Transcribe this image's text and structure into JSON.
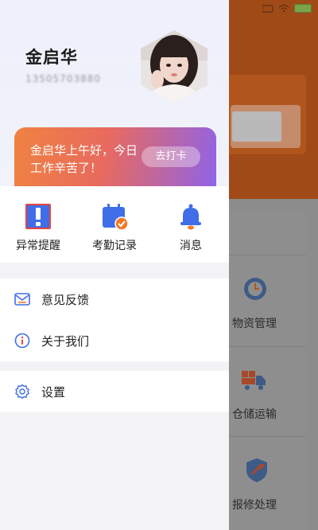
{
  "status_bar": {
    "battery_icon": "battery-icon",
    "wifi_icon": "wifi-icon",
    "signal_icon": "signal-icon"
  },
  "profile": {
    "name": "金启华",
    "phone": "13505703880",
    "avatar_icon": "avatar"
  },
  "greeting": {
    "message": "金启华上午好，今日工作辛苦了！",
    "button_label": "去打卡",
    "gradient": [
      "#f08242",
      "#e86a5e",
      "#8f63e8"
    ]
  },
  "quick_actions": [
    {
      "label": "异常提醒",
      "icon": "exclamation-icon"
    },
    {
      "label": "考勤记录",
      "icon": "calendar-check-icon"
    },
    {
      "label": "消息",
      "icon": "bell-icon"
    }
  ],
  "menu": {
    "feedback": {
      "label": "意见反馈",
      "icon": "mail-icon"
    },
    "about": {
      "label": "关于我们",
      "icon": "info-icon"
    },
    "settings": {
      "label": "设置",
      "icon": "gear-icon"
    }
  },
  "background_app": {
    "items": [
      {
        "label": "物资管理",
        "icon": "clock-icon"
      },
      {
        "label": "仓储运输",
        "icon": "truck-icon"
      },
      {
        "label": "报修处理",
        "icon": "wrench-shield-icon"
      }
    ]
  },
  "colors": {
    "accent_blue": "#3f6ee8",
    "warning_red": "#e8453c",
    "drawer_bg": "#f3f3f6"
  }
}
